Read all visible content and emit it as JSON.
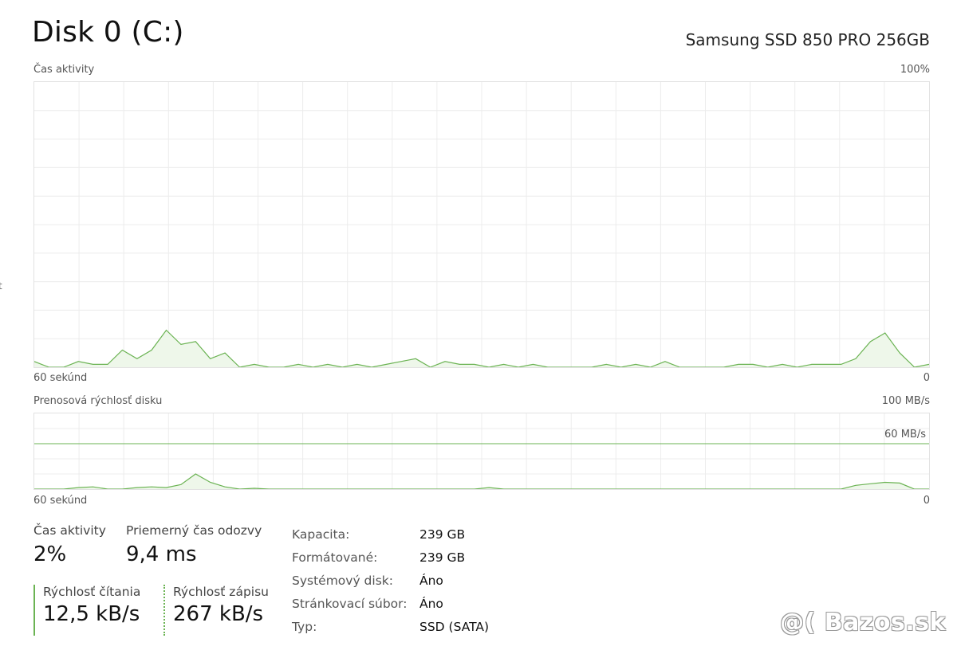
{
  "header": {
    "disk_title": "Disk 0 (C:)",
    "model": "Samsung SSD 850 PRO 256GB"
  },
  "activity_chart": {
    "label": "Čas aktivity",
    "max_label": "100%",
    "time_label": "60 sekúnd",
    "min_label": "0",
    "line_color": "#6bb353",
    "fill_color": "#eef7ea",
    "values": [
      2,
      0,
      0,
      2,
      1,
      1,
      6,
      3,
      6,
      13,
      8,
      9,
      3,
      5,
      0,
      1,
      0,
      0,
      1,
      0,
      1,
      0,
      1,
      0,
      1,
      2,
      3,
      0,
      2,
      1,
      1,
      0,
      1,
      0,
      1,
      0,
      0,
      0,
      0,
      1,
      0,
      1,
      0,
      2,
      0,
      0,
      0,
      0,
      1,
      1,
      0,
      1,
      0,
      1,
      1,
      1,
      3,
      9,
      12,
      5,
      0,
      1
    ]
  },
  "transfer_chart": {
    "label": "Prenosová rýchlosť disku",
    "max_label": "100 MB/s",
    "ref_label": "60 MB/s",
    "time_label": "60 sekúnd",
    "min_label": "0",
    "line_color": "#6bb353",
    "fill_color": "#eef7ea",
    "values": [
      0,
      0,
      0,
      2,
      3,
      0,
      0,
      2,
      3,
      2,
      6,
      20,
      9,
      3,
      0,
      1,
      0,
      0,
      0,
      0,
      0,
      0,
      0,
      0,
      0,
      0,
      0,
      0,
      0,
      0,
      0,
      2,
      0,
      0,
      0,
      0,
      0,
      0,
      0,
      0,
      0,
      0,
      0,
      0,
      0,
      0,
      0,
      0,
      0,
      0,
      0,
      0,
      0,
      0,
      0,
      0,
      5,
      7,
      9,
      8,
      0,
      0
    ]
  },
  "stats": {
    "activity": {
      "label": "Čas aktivity",
      "value": "2%"
    },
    "response": {
      "label": "Priemerný čas odozvy",
      "value": "9,4 ms"
    },
    "read": {
      "label": "Rýchlosť čítania",
      "value": "12,5 kB/s"
    },
    "write": {
      "label": "Rýchlosť zápisu",
      "value": "267 kB/s"
    }
  },
  "properties": [
    {
      "key": "Kapacita:",
      "value": "239 GB"
    },
    {
      "key": "Formátované:",
      "value": "239 GB"
    },
    {
      "key": "Systémový disk:",
      "value": "Áno"
    },
    {
      "key": "Stránkovací súbor:",
      "value": "Áno"
    },
    {
      "key": "Typ:",
      "value": "SSD (SATA)"
    }
  ],
  "watermark": "@( Bazos.sk",
  "side_mark": "t"
}
